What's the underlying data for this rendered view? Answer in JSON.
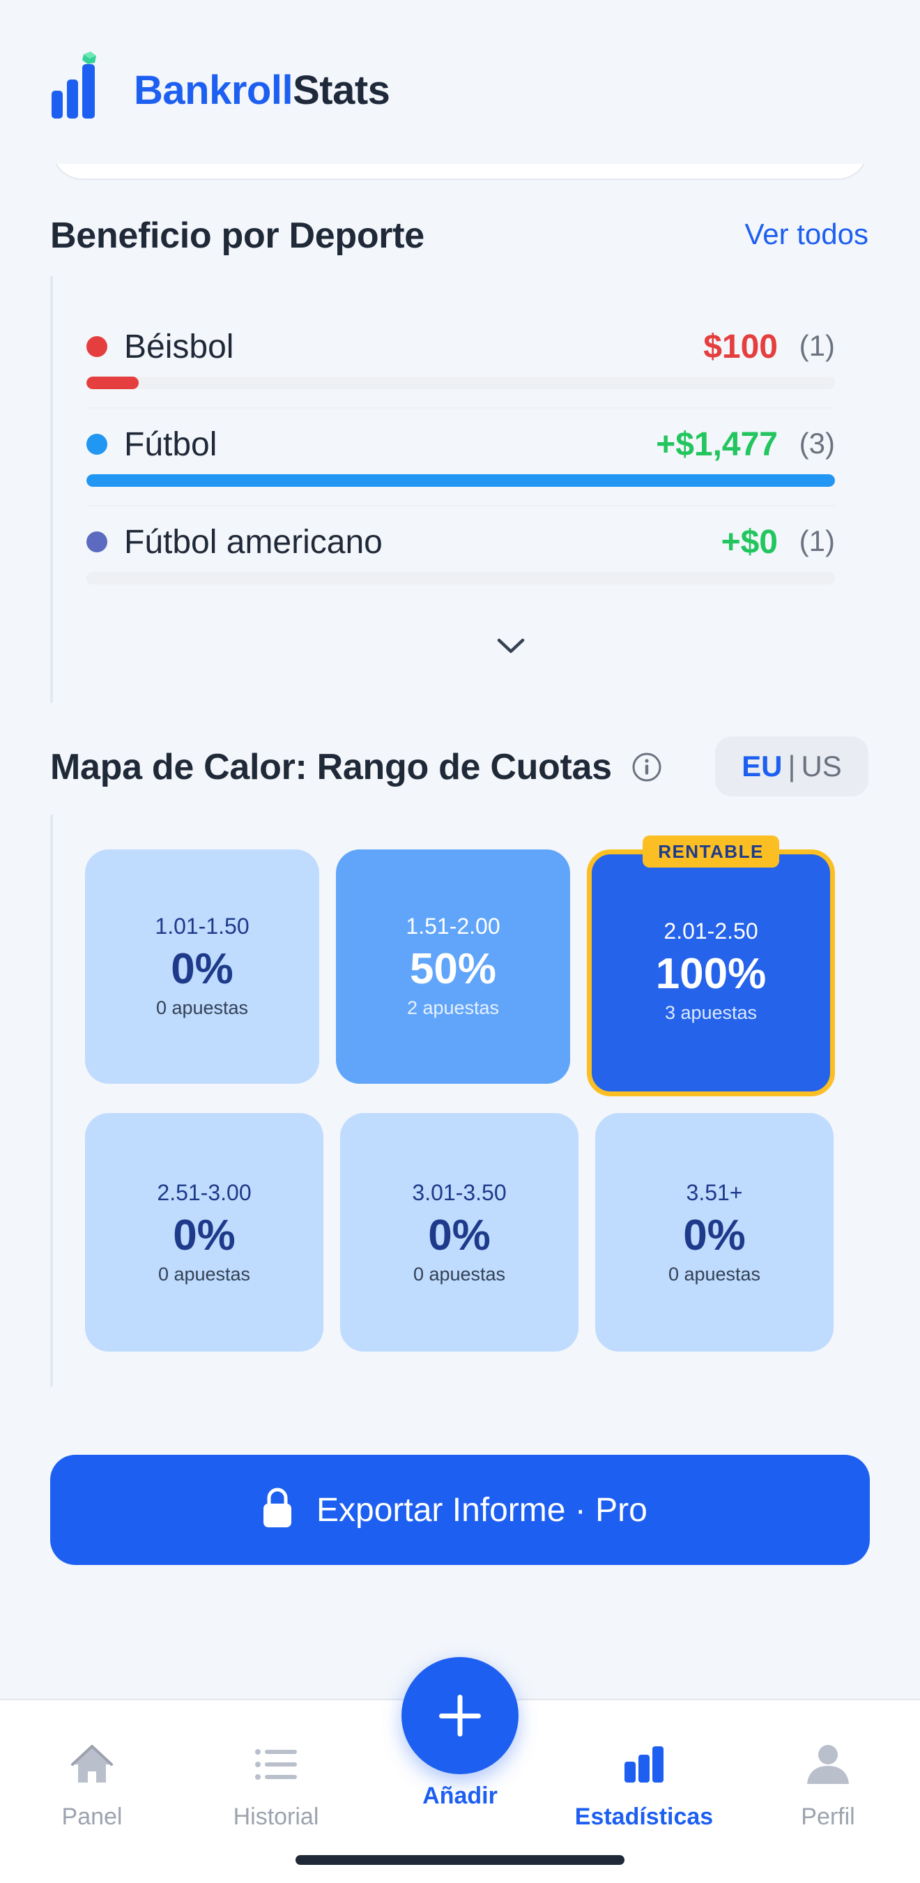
{
  "app": {
    "brand_part1": "Bankroll",
    "brand_part2": "Stats"
  },
  "sports_section": {
    "title": "Beneficio por Deporte",
    "see_all": "Ver todos",
    "rows": [
      {
        "name": "Béisbol",
        "amount": "$100",
        "count": "(1)",
        "color": "#e53e3e",
        "amount_color": "#e53e3e",
        "bar_fraction": 0.07
      },
      {
        "name": "Fútbol",
        "amount": "+$1,477",
        "count": "(3)",
        "color": "#2196f3",
        "amount_color": "#22c55e",
        "bar_fraction": 1.0
      },
      {
        "name": "Fútbol americano",
        "amount": "+$0",
        "count": "(1)",
        "color": "#5c6bc0",
        "amount_color": "#22c55e",
        "bar_fraction": 0
      }
    ]
  },
  "heatmap": {
    "title": "Mapa de Calor: Rango de Cuotas",
    "units": {
      "active": "EU",
      "separator": "|",
      "inactive": "US"
    },
    "badge": "RENTABLE",
    "cells": [
      {
        "range": "1.01-1.50",
        "pct": "0%",
        "bets": "0 apuestas"
      },
      {
        "range": "1.51-2.00",
        "pct": "50%",
        "bets": "2 apuestas"
      },
      {
        "range": "2.01-2.50",
        "pct": "100%",
        "bets": "3 apuestas"
      },
      {
        "range": "2.51-3.00",
        "pct": "0%",
        "bets": "0 apuestas"
      },
      {
        "range": "3.01-3.50",
        "pct": "0%",
        "bets": "0 apuestas"
      },
      {
        "range": "3.51+",
        "pct": "0%",
        "bets": "0 apuestas"
      }
    ]
  },
  "export": {
    "label": "Exportar Informe · Pro"
  },
  "nav": {
    "items": [
      {
        "label": "Panel",
        "icon": "home-icon"
      },
      {
        "label": "Historial",
        "icon": "list-icon"
      },
      {
        "label": "Añadir",
        "icon": "plus-icon"
      },
      {
        "label": "Estadísticas",
        "icon": "bar-chart-icon"
      },
      {
        "label": "Perfil",
        "icon": "user-icon"
      }
    ],
    "active": "Estadísticas"
  },
  "colors": {
    "accent": "#1d5ff0",
    "positive": "#22c55e",
    "negative": "#e53e3e",
    "highlight": "#fbbf24"
  }
}
